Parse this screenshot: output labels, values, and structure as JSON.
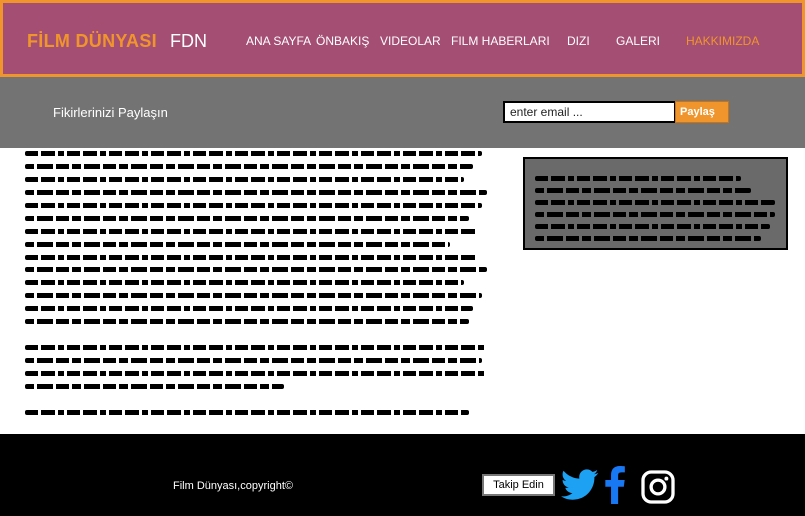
{
  "header": {
    "brand": "FİLM DÜNYASI",
    "short": "FDN",
    "nav": [
      "ANA SAYFA",
      "ÖNBAKIŞ",
      "VIDEOLAR",
      "FILM HABERLARI",
      "DIZI",
      "GALERI",
      "HAKKIMIZDA"
    ],
    "active": "HAKKIMIZDA"
  },
  "share": {
    "label": "Fikirlerinizi Paylaşın",
    "email_placeholder": "enter email ...",
    "button": "Paylaş"
  },
  "footer": {
    "copyright": "Film Dünyası,copyright©",
    "follow": "Takip Edin",
    "social": [
      "twitter-icon",
      "facebook-icon",
      "instagram-icon"
    ]
  },
  "colors": {
    "header_bg": "#a44e74",
    "accent": "#f0952c",
    "sharebar_bg": "#737373",
    "sidebox_bg": "#6a6a6a",
    "footer_bg": "#000000",
    "twitter": "#1da1f2",
    "facebook": "#1877f2"
  }
}
